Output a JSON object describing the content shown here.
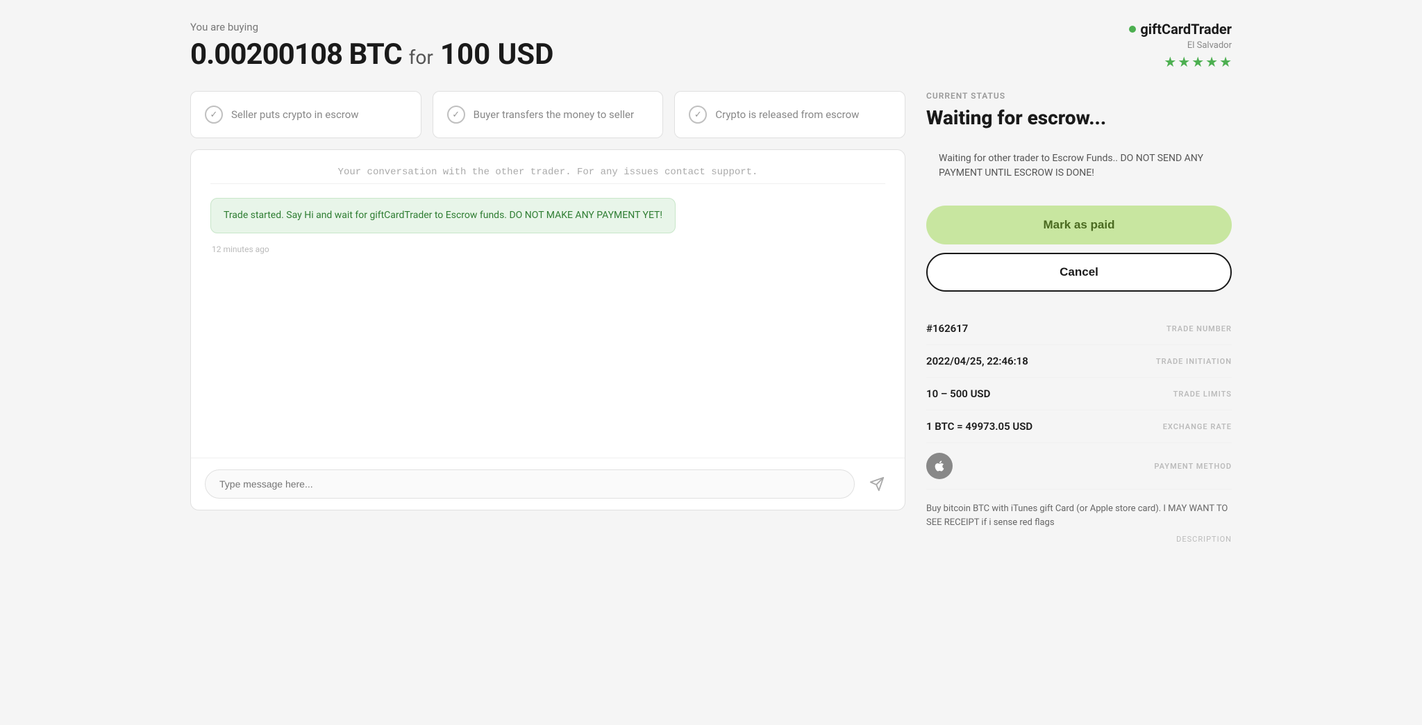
{
  "header": {
    "you_are_buying": "You are buying",
    "btc_amount": "0.00200108 BTC",
    "for_label": "for",
    "usd_amount": "100 USD"
  },
  "seller": {
    "name": "giftCardTrader",
    "location": "El Salvador",
    "stars": 5
  },
  "steps": [
    {
      "text": "Seller puts crypto in escrow",
      "icon": "✓"
    },
    {
      "text": "Buyer transfers the money to seller",
      "icon": "✓"
    },
    {
      "text": "Crypto is released from escrow",
      "icon": "✓"
    }
  ],
  "chat": {
    "system_message": "Your conversation with the other trader. For any issues contact support.",
    "placeholder": "Type message here...",
    "bubble_text": "Trade started. Say Hi and wait for giftCardTrader to Escrow funds. DO NOT MAKE ANY PAYMENT YET!",
    "timestamp": "12 minutes ago"
  },
  "status": {
    "label": "CURRENT STATUS",
    "title": "Waiting for escrow...",
    "warning": "Waiting for other trader to Escrow Funds.. DO NOT SEND ANY PAYMENT UNTIL ESCROW IS DONE!",
    "mark_paid_label": "Mark as paid",
    "cancel_label": "Cancel"
  },
  "trade_details": {
    "trade_number": {
      "value": "#162617",
      "label": "TRADE NUMBER"
    },
    "trade_initiation": {
      "value": "2022/04/25, 22:46:18",
      "label": "TRADE INITIATION"
    },
    "trade_limits": {
      "value": "10 – 500 USD",
      "label": "TRADE LIMITS"
    },
    "exchange_rate": {
      "value": "1 BTC = 49973.05 USD",
      "label": "EXCHANGE RATE"
    },
    "payment_method_label": "PAYMENT METHOD",
    "description": {
      "text": "Buy bitcoin BTC with iTunes gift Card (or Apple store card). I MAY WANT TO SEE RECEIPT if i sense red flags",
      "label": "DESCRIPTION"
    }
  }
}
